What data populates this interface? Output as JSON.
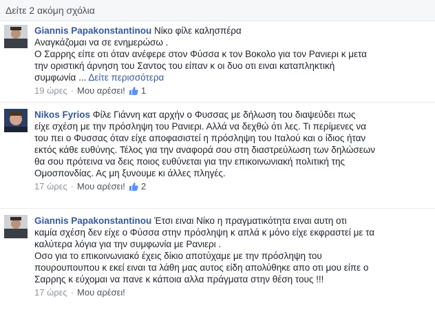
{
  "more_comments": "Δείτε 2 ακόμη σχόλια",
  "like_label": "Μου αρέσει!",
  "comments": [
    {
      "author": "Giannis Papakonstantinou",
      "lines": [
        "Νίκο φίλε καλησπέρα",
        "Αναγκάζομαι να σε ενημερώσω .",
        "Ο Σαρρης είπε οτι όταν ανέφερε στον Φύσσα κ τον Βοκολο για τον Ρανιερι κ μετα",
        "την οριστική άρνηση του Σαντος του είπαν κ οι δυο οτι ειναι καταπληκτική",
        "συμφωνία ..."
      ],
      "see_more": "Δείτε περισσότερα",
      "time": "19 ώρες",
      "likes": "1"
    },
    {
      "author": "Nikos Fyrios",
      "lines": [
        "Φίλε Γιάννη κατ αρχήν ο Φυσσας με δήλωση του διαψεύδει πως",
        "είχε σχέση με την πρόσληψη του Ρανιερι. Αλλά να δεχθώ ότι λες. Τι περίμενες να",
        "του πει ο Φυσσας όταν είχε αποφασιστεί η πρόσληψη του Ιταλού και ο ίδιος ήταν",
        "εκτός κάθε ευθύνης. Τέλος για την αναφορά σου στη διαστρεύλωση των δηλώσεων",
        "θα σου πρότεινα να δεις ποιος ευθύνεται για την επικοινωνιακή πολιτική της",
        "Ομοσπονδίας. Ας μη ξυνουμε κι άλλες πληγές."
      ],
      "time": "17 ώρες",
      "likes": "2"
    },
    {
      "author": "Giannis Papakonstantinou",
      "lines": [
        "Έτσι ειναι Νίκο η πραγματικότητα ειναι αυτη οτι",
        "καμία σχέση δεν είχε ο Φύσσα στην πρόσληψη κ απλά κ μόνο είχε εκφραστεί με τα",
        "καλύτερα λόγια για την συμφωνία με Ρανιερι .",
        "Οσο για το επικοινωνιακό έχεις δίκιο αποτύχαμε με την πρόσληψη του",
        "πουρουπουπου κ εκεί ειναι τα λάθη μας αυτος είδη απολύθηκε απο οτι μου είπε ο",
        "Σαρρης κ εύχομαι να πανε κ κάποια αλλα πράγματα στην θέση τους !!!"
      ],
      "time": "17 ώρες",
      "likes": ""
    }
  ]
}
